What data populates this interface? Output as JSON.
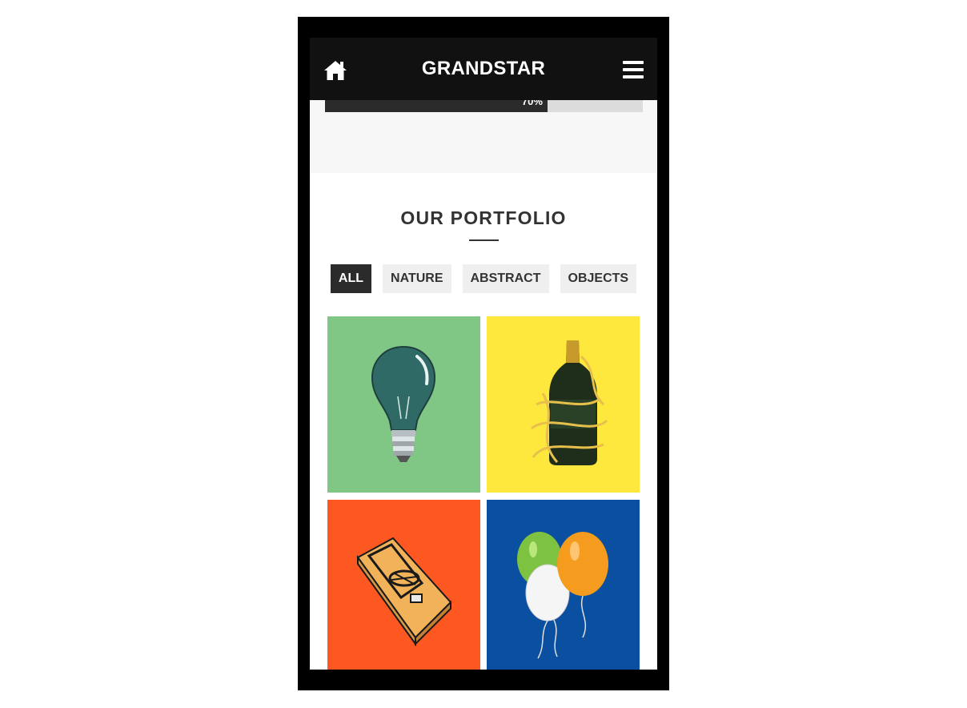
{
  "header": {
    "brand": "GRANDSTAR"
  },
  "progress": {
    "label": "70%",
    "value": 0.7
  },
  "portfolio": {
    "title": "OUR PORTFOLIO",
    "filters": [
      "ALL",
      "NATURE",
      "ABSTRACT",
      "OBJECTS"
    ],
    "active_filter": "ALL",
    "items": [
      {
        "name": "light-bulb",
        "bg": "#80c785"
      },
      {
        "name": "champagne-bottle",
        "bg": "#ffe83d"
      },
      {
        "name": "mouse-trap",
        "bg": "#fd5722"
      },
      {
        "name": "balloons",
        "bg": "#0a4fa0"
      }
    ]
  },
  "colors": {
    "topbar": "#111111",
    "accent_dark": "#2b2b2b",
    "chip_bg": "#efefef"
  }
}
